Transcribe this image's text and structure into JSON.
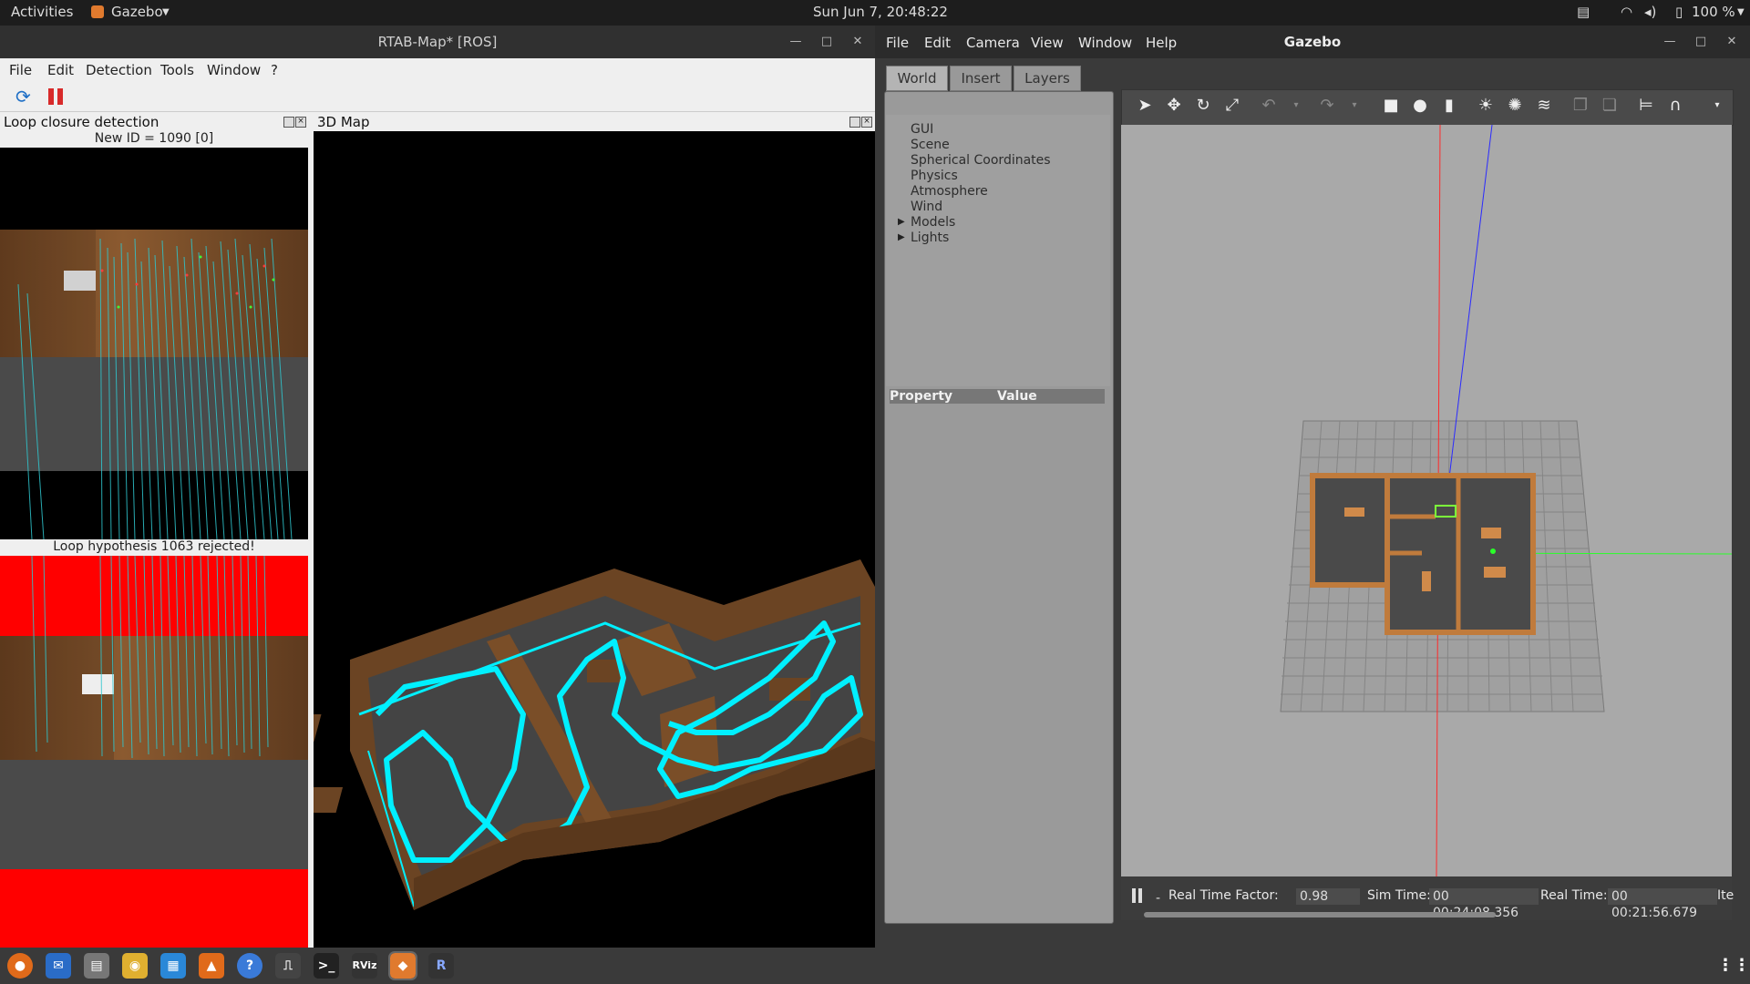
{
  "topbar": {
    "activities": "Activities",
    "app": "Gazebo",
    "clock": "Sun Jun  7, 20:48:22",
    "battery": "100 %"
  },
  "rtab": {
    "title": "RTAB-Map* [ROS]",
    "menu": [
      "File",
      "Edit",
      "Detection",
      "Tools",
      "Window",
      "?"
    ],
    "loop_panel_title": "Loop closure detection",
    "new_id": "New ID = 1090 [0]",
    "loop_status": "Loop hypothesis 1063 rejected!",
    "map_panel_title": "3D Map"
  },
  "gazebo": {
    "title": "Gazebo",
    "menu": [
      "File",
      "Edit",
      "Camera",
      "View",
      "Window",
      "Help"
    ],
    "tabs": [
      "World",
      "Insert",
      "Layers"
    ],
    "tree": [
      "GUI",
      "Scene",
      "Spherical Coordinates",
      "Physics",
      "Atmosphere",
      "Wind",
      "Models",
      "Lights"
    ],
    "prop_header": "Property",
    "value_header": "Value",
    "status": {
      "rtf_label": "Real Time Factor:",
      "rtf_value": "0.98",
      "sim_label": "Sim Time:",
      "sim_value": "00 00:24:08.356",
      "real_label": "Real Time:",
      "real_value": "00 00:21:56.679",
      "iter_label": "Ite"
    }
  },
  "colors": {
    "cyan": "#00f0ff",
    "red": "#ff0000",
    "wood": "#7a4a24",
    "grid_bg": "#a9a9a9"
  }
}
